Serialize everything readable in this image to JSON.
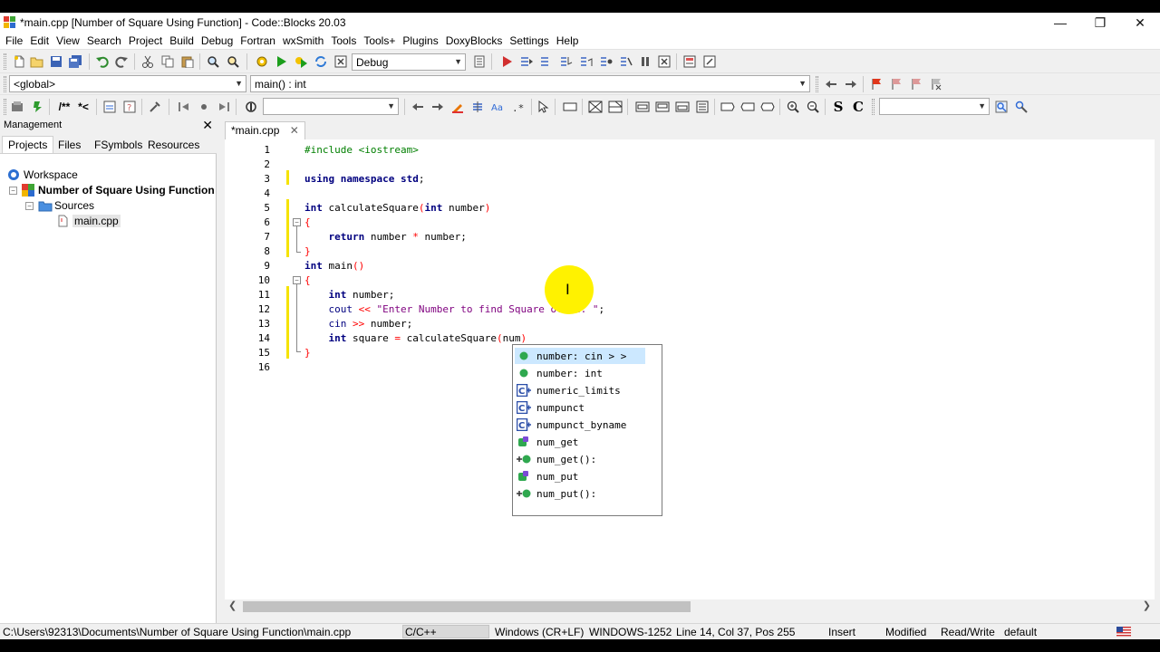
{
  "window": {
    "title": "*main.cpp [Number of Square Using Function] - Code::Blocks 20.03",
    "minimize": "—",
    "restore": "❐",
    "close": "✕"
  },
  "menu": [
    "File",
    "Edit",
    "View",
    "Search",
    "Project",
    "Build",
    "Debug",
    "Fortran",
    "wxSmith",
    "Tools",
    "Tools+",
    "Plugins",
    "DoxyBlocks",
    "Settings",
    "Help"
  ],
  "toolbar": {
    "build_target": "Debug",
    "scope": "<global>",
    "function": "main() : int",
    "search_text": "",
    "find_text": "",
    "doxy_comment": "/**",
    "doxy_inline": "*<",
    "sym_s": "S",
    "sym_c": "C"
  },
  "management": {
    "title": "Management",
    "close": "✕",
    "tabs": [
      "Projects",
      "Files",
      "FSymbols",
      "Resources"
    ],
    "tree": {
      "workspace": "Workspace",
      "project": "Number of Square Using Function",
      "folder": "Sources",
      "file": "main.cpp"
    }
  },
  "editor": {
    "tab_label": "*main.cpp",
    "tab_close": "✕",
    "line_numbers": [
      "1",
      "2",
      "3",
      "4",
      "5",
      "6",
      "7",
      "8",
      "9",
      "10",
      "11",
      "12",
      "13",
      "14",
      "15",
      "16"
    ],
    "lines": [
      "#include <iostream>",
      "",
      "using namespace std;",
      "",
      "int calculateSquare(int number)",
      "{",
      "    return number * number;",
      "}",
      "int main()",
      "{",
      "    int number;",
      "    cout << \"Enter Number to find Square of it: \";",
      "    cin >> number;",
      "    int square = calculateSquare(num)",
      "}",
      ""
    ]
  },
  "autocomplete": {
    "items": [
      {
        "label": "number: cin > >",
        "icon": "variable-icon",
        "selected": true
      },
      {
        "label": "number: int",
        "icon": "variable-icon",
        "selected": false
      },
      {
        "label": "numeric_limits",
        "icon": "class-icon",
        "selected": false
      },
      {
        "label": "numpunct",
        "icon": "class-icon",
        "selected": false
      },
      {
        "label": "numpunct_byname",
        "icon": "class-icon",
        "selected": false
      },
      {
        "label": "num_get",
        "icon": "function-icon",
        "selected": false
      },
      {
        "label": "num_get():",
        "icon": "constructor-icon",
        "selected": false
      },
      {
        "label": "num_put",
        "icon": "function-icon",
        "selected": false
      },
      {
        "label": "num_put():",
        "icon": "constructor-icon",
        "selected": false
      }
    ]
  },
  "status": {
    "path": "C:\\Users\\92313\\Documents\\Number of Square Using Function\\main.cpp",
    "language": "C/C++",
    "eol": "Windows (CR+LF)",
    "encoding": "WINDOWS-1252",
    "position": "Line 14, Col 37, Pos 255",
    "mode": "Insert",
    "modified": "Modified",
    "access": "Read/Write",
    "profile": "default"
  },
  "colors": {
    "preprocessor": "#007f00",
    "keyword": "#00007f",
    "string": "#7f007f",
    "operator": "#ff0000",
    "change_bar": "#f5e300",
    "cursor_highlight": "#fff200",
    "selection": "#cce8ff"
  }
}
